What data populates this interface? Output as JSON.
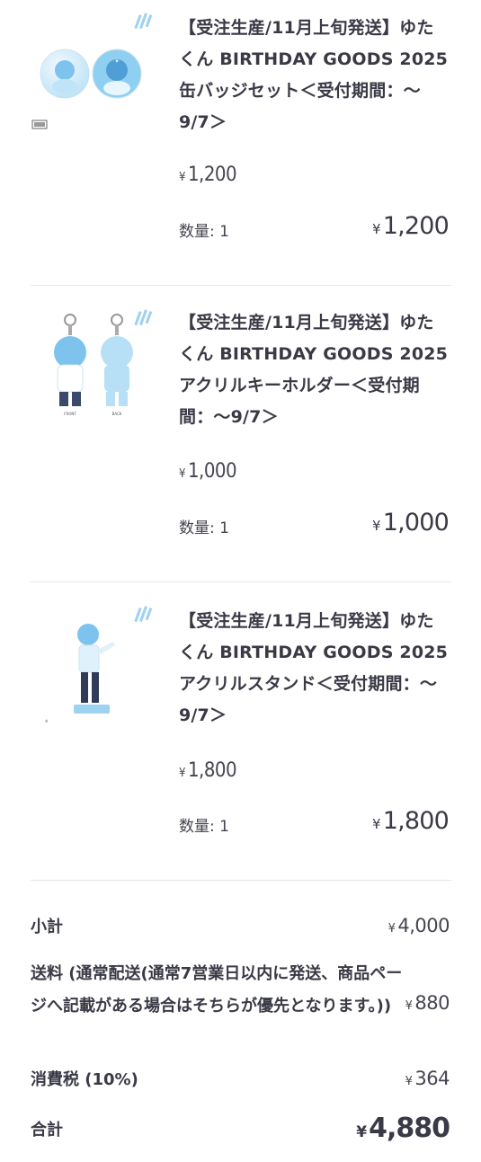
{
  "items": [
    {
      "title": "【受注生産/11月上旬発送】ゆたくん BIRTHDAY GOODS 2025 缶バッジセット＜受付期間：〜9/7＞",
      "currency": "¥",
      "unit_price": "1,200",
      "qty_label": "数量: 1",
      "line_total": "1,200",
      "thumbnail_icon": "badge-set-image"
    },
    {
      "title": "【受注生産/11月上旬発送】ゆたくん BIRTHDAY GOODS 2025 アクリルキーホルダー＜受付期間：〜9/7＞",
      "currency": "¥",
      "unit_price": "1,000",
      "qty_label": "数量: 1",
      "line_total": "1,000",
      "thumbnail_icon": "acrylic-keychain-image"
    },
    {
      "title": "【受注生産/11月上旬発送】ゆたくん BIRTHDAY GOODS 2025 アクリルスタンド＜受付期間：〜9/7＞",
      "currency": "¥",
      "unit_price": "1,800",
      "qty_label": "数量: 1",
      "line_total": "1,800",
      "thumbnail_icon": "acrylic-stand-image"
    }
  ],
  "summary": {
    "currency": "¥",
    "subtotal_label": "小計",
    "subtotal_value": "4,000",
    "shipping_label": "送料 (通常配送(通常7営業日以内に発送、商品ページへ記載がある場合はそちらが優先となります。))",
    "shipping_value": "880",
    "tax_label": "消費税 (10%)",
    "tax_value": "364",
    "total_label": "合計",
    "total_value": "4,880"
  },
  "colors": {
    "text": "#3a3a46",
    "divider": "#e6e6e6",
    "accent_blue": "#7ec3ee"
  }
}
